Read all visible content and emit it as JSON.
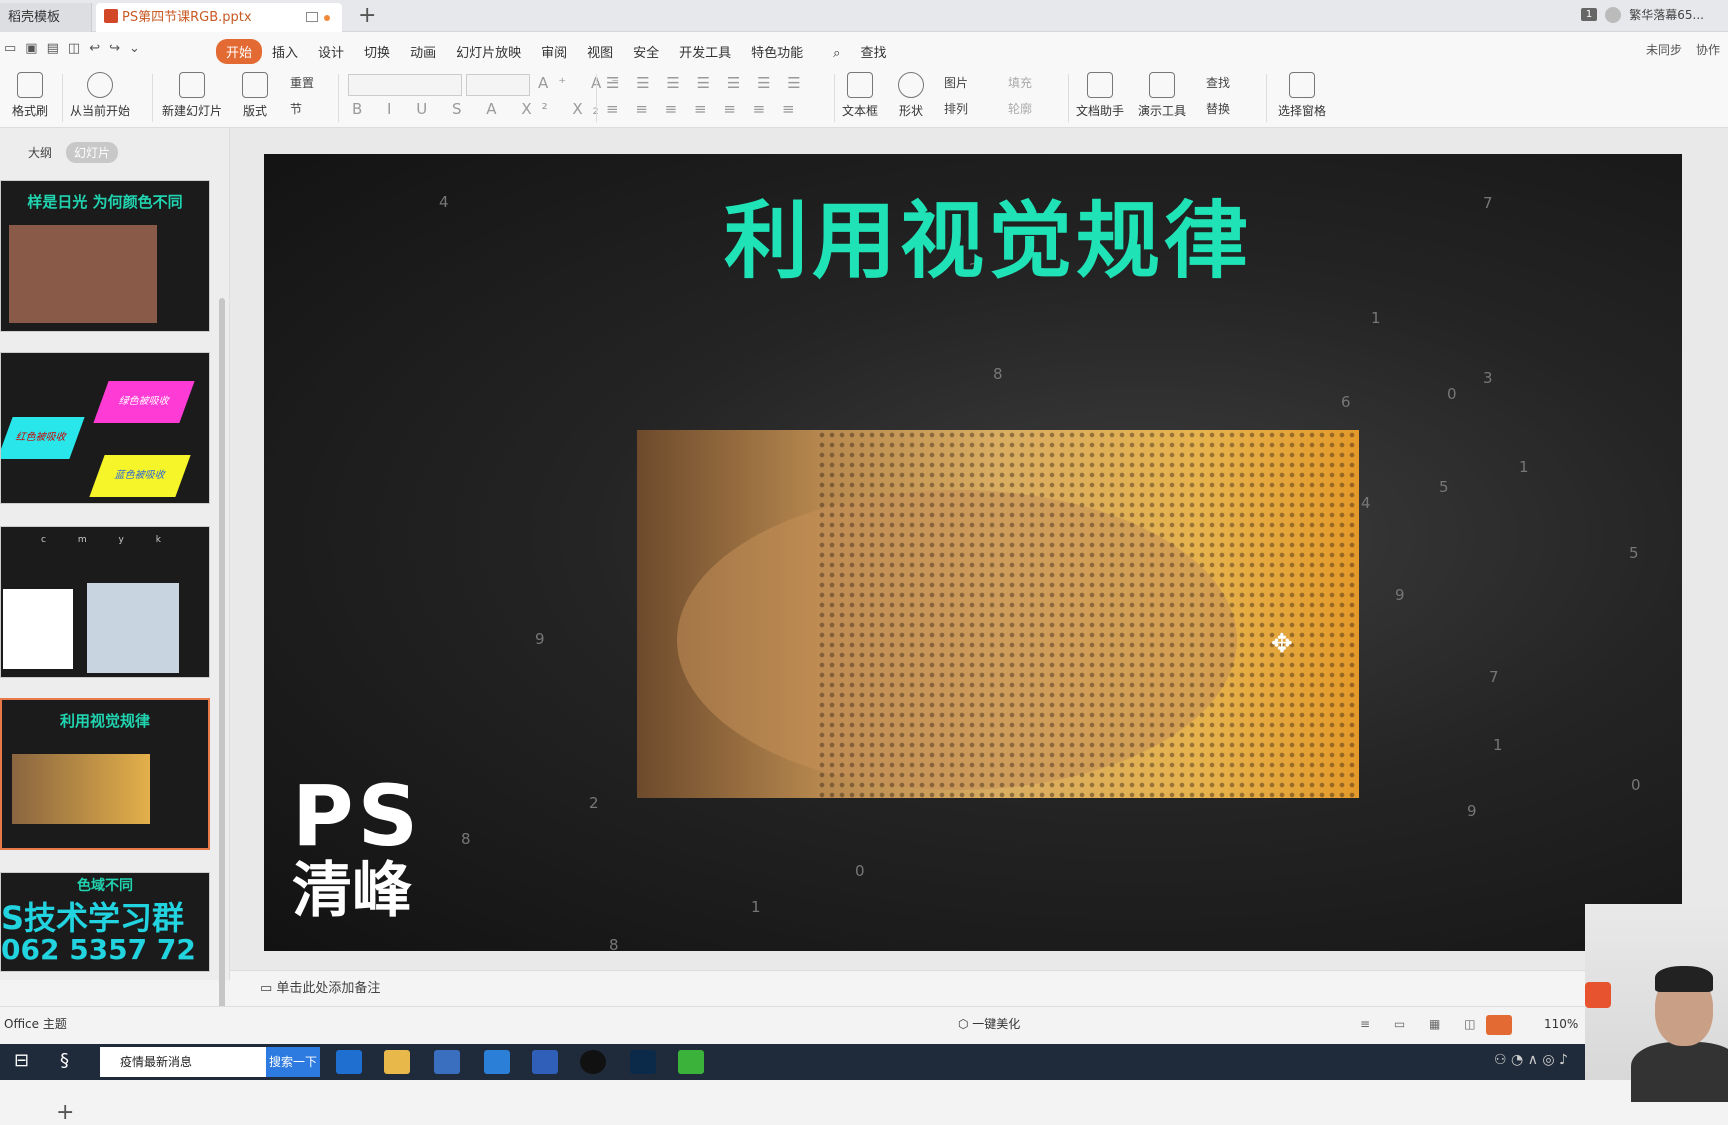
{
  "tabs": {
    "template": "稻壳模板",
    "document": "PS第四节课RGB.pptx"
  },
  "account": {
    "badge": "1",
    "user": "繁华落幕65..."
  },
  "quick_access": [
    "↩",
    "↪",
    "⌄"
  ],
  "menu": {
    "items": [
      "开始",
      "插入",
      "设计",
      "切换",
      "动画",
      "幻灯片放映",
      "审阅",
      "视图",
      "安全",
      "开发工具",
      "特色功能"
    ],
    "search": "查找",
    "sync": "未同步",
    "collab": "协作"
  },
  "ribbon": {
    "format_painter": "格式刷",
    "from_current": "从当前开始",
    "new_slide": "新建幻灯片",
    "layout": "版式",
    "reset": "重置",
    "section": "节",
    "font_row1": "A⁺ A⁻",
    "font_row2": "B I U S A X² X₂",
    "textbox": "文本框",
    "shape": "形状",
    "picture": "图片",
    "fill": "填充",
    "arrange": "排列",
    "outline": "轮廓",
    "doc_helper": "文档助手",
    "present_tool": "演示工具",
    "find": "查找",
    "replace": "替换",
    "select_pane": "选择窗格"
  },
  "panel": {
    "tab_outline": "大纲",
    "tab_slides": "幻灯片"
  },
  "thumbnails": [
    {
      "caption": "样是日光 为何颜色不同"
    },
    {
      "caption": "",
      "labels": [
        "绿色被吸收",
        "红色被吸收",
        "蓝色被吸收"
      ]
    },
    {
      "caption": "",
      "labels": [
        "c",
        "m",
        "y",
        "k"
      ]
    },
    {
      "caption": "利用视觉规律"
    },
    {
      "caption": "色域不同",
      "overlay1": "S技术学习群",
      "overlay2": "062 5357 72"
    }
  ],
  "slide": {
    "title": "利用视觉规律",
    "logo_ps": "PS",
    "logo_qf": "清峰",
    "tile_numbers": [
      "4",
      "2",
      "8",
      "9",
      "2",
      "8",
      "0",
      "1",
      "8",
      "7",
      "1",
      "6",
      "0",
      "3",
      "5",
      "4",
      "1",
      "9",
      "7",
      "5",
      "0",
      "9",
      "1"
    ]
  },
  "notes": "单击此处添加备注",
  "status": {
    "theme": "Office 主题",
    "beautify": "一键美化",
    "zoom": "110%"
  },
  "taskbar": {
    "search_text": "疫情最新消息",
    "search_btn": "搜索一下"
  },
  "colors": {
    "accent": "#e36b33",
    "title": "#1fe2b6"
  }
}
